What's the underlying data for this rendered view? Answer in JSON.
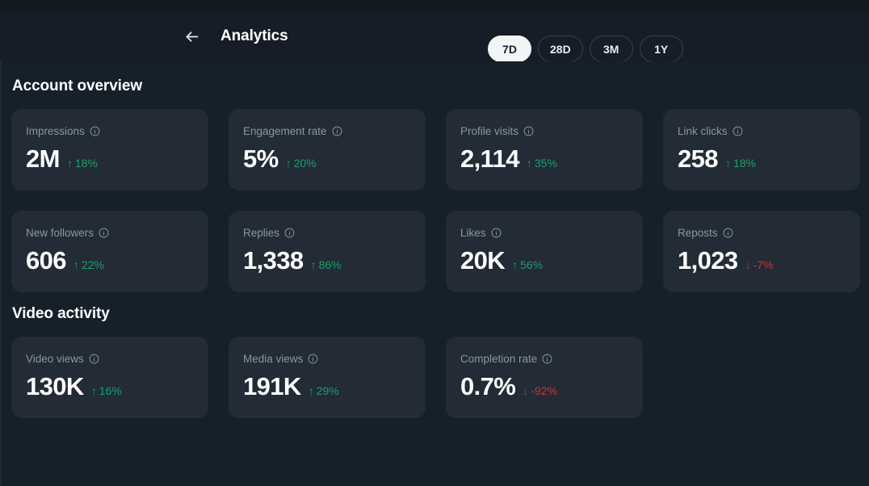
{
  "header": {
    "back_icon": "arrow-left-icon",
    "title": "Analytics",
    "ranges": [
      {
        "label": "7D",
        "active": true
      },
      {
        "label": "28D",
        "active": false
      },
      {
        "label": "3M",
        "active": false
      },
      {
        "label": "1Y",
        "active": false
      }
    ]
  },
  "colors": {
    "page_bg": "#15202b",
    "card_bg": "#222b36",
    "positive": "#1c9e6b",
    "negative": "#d2303a",
    "label": "#8a97a4",
    "value": "#ffffff"
  },
  "sections": [
    {
      "title": "Account overview",
      "cards": [
        {
          "label": "Impressions",
          "info_icon": "info-icon",
          "value": "2M",
          "delta": "18%",
          "direction": "up",
          "arrow": "↑"
        },
        {
          "label": "Engagement rate",
          "info_icon": "info-icon",
          "value": "5%",
          "delta": "20%",
          "direction": "up",
          "arrow": "↑"
        },
        {
          "label": "Profile visits",
          "info_icon": "info-icon",
          "value": "2,114",
          "delta": "35%",
          "direction": "up",
          "arrow": "↑"
        },
        {
          "label": "Link clicks",
          "info_icon": "info-icon",
          "value": "258",
          "delta": "18%",
          "direction": "up",
          "arrow": "↑"
        },
        {
          "label": "New followers",
          "info_icon": "info-icon",
          "value": "606",
          "delta": "22%",
          "direction": "up",
          "arrow": "↑"
        },
        {
          "label": "Replies",
          "info_icon": "info-icon",
          "value": "1,338",
          "delta": "86%",
          "direction": "up",
          "arrow": "↑"
        },
        {
          "label": "Likes",
          "info_icon": "info-icon",
          "value": "20K",
          "delta": "56%",
          "direction": "up",
          "arrow": "↑"
        },
        {
          "label": "Reposts",
          "info_icon": "info-icon",
          "value": "1,023",
          "delta": "-7%",
          "direction": "down",
          "arrow": "↓"
        }
      ]
    },
    {
      "title": "Video activity",
      "cards": [
        {
          "label": "Video views",
          "info_icon": "info-icon",
          "value": "130K",
          "delta": "16%",
          "direction": "up",
          "arrow": "↑"
        },
        {
          "label": "Media views",
          "info_icon": "info-icon",
          "value": "191K",
          "delta": "29%",
          "direction": "up",
          "arrow": "↑"
        },
        {
          "label": "Completion rate",
          "info_icon": "info-icon",
          "value": "0.7%",
          "delta": "-92%",
          "direction": "down",
          "arrow": "↓"
        }
      ]
    }
  ]
}
